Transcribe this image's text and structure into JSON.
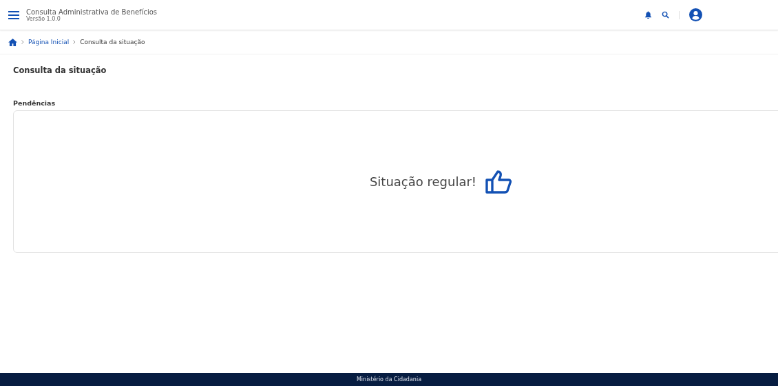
{
  "header": {
    "title": "Consulta Administrativa de Benefícios",
    "version": "Versão 1.0.0"
  },
  "breadcrumb": [
    {
      "label": "Página Inicial",
      "link": true
    },
    {
      "label": "Consulta da situação",
      "link": false
    }
  ],
  "page_title": "Consulta da situação",
  "section": {
    "title": "Pendências",
    "message": "Situação regular!"
  },
  "footer": "Ministério da Cidadania"
}
